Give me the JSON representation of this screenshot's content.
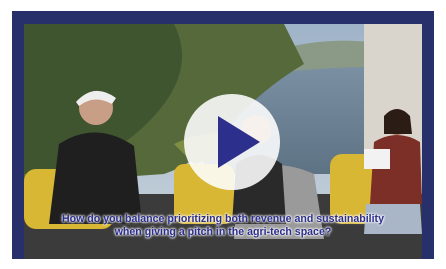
{
  "video": {
    "caption_line1": "How do you balance prioritizing both revenue and sustainability",
    "caption_line2": "when giving a pitch in the agri-tech space?",
    "play_icon": "play-icon"
  },
  "colors": {
    "frame": "#27306b",
    "caption": "#2d2f8c",
    "play_bg": "#ffffff",
    "play_triangle": "#2d2f8c"
  }
}
